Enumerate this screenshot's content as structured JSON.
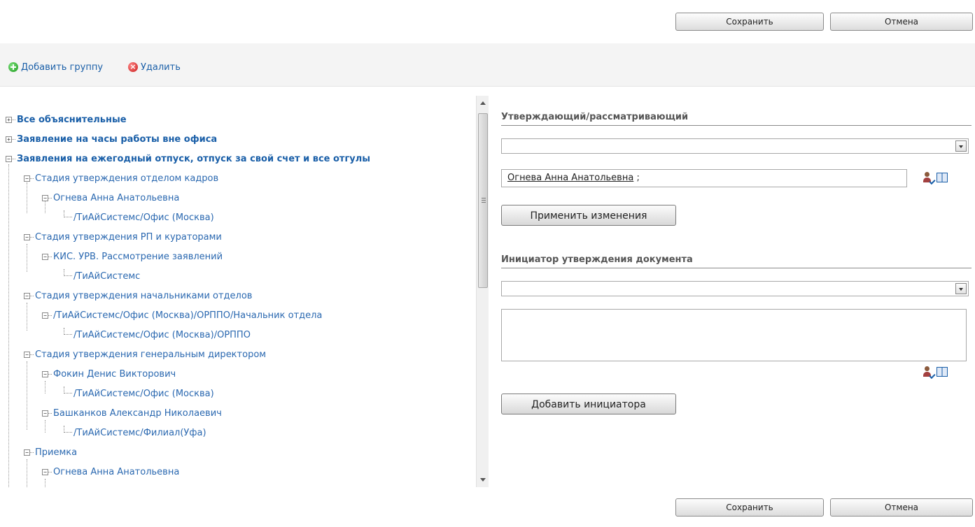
{
  "header": {
    "save_label": "Сохранить",
    "cancel_label": "Отмена"
  },
  "toolbar": {
    "add_group_label": "Добавить группу",
    "delete_label": "Удалить"
  },
  "tree": {
    "roots": [
      "Все объяснительные",
      "Заявление на часы работы вне офиса",
      "Заявления на ежегодный отпуск, отпуск за свой счет и все отгулы"
    ],
    "nodes": [
      "Стадия утверждения отделом кадров",
      "Огнева Анна Анатольевна",
      "/ТиАйСистемс/Офис (Москва)",
      "Стадия утверждения РП и кураторами",
      "КИС. УРВ. Рассмотрение заявлений",
      "/ТиАйСистемс",
      "Стадия утверждения начальниками отделов",
      "/ТиАйСистемс/Офис (Москва)/ОРППО/Начальник отдела",
      "/ТиАйСистемс/Офис (Москва)/ОРППО",
      "Стадия утверждения генеральным директором",
      "Фокин Денис Викторович",
      "/ТиАйСистемс/Офис (Москва)",
      "Башканков Александр Николаевич",
      "/ТиАйСистемс/Филиал(Уфа)",
      "Приемка",
      "Огнева Анна Анатольевна"
    ]
  },
  "approver": {
    "section_title": "Утверждающий/рассматривающий",
    "select_value": "",
    "selected_person": "Огнева Анна Анатольевна",
    "separator": ";",
    "apply_label": "Применить изменения"
  },
  "initiator": {
    "section_title": "Инициатор утверждения документа",
    "select_value": "",
    "add_label": "Добавить инициатора"
  },
  "footer": {
    "save_label": "Сохранить",
    "cancel_label": "Отмена"
  }
}
